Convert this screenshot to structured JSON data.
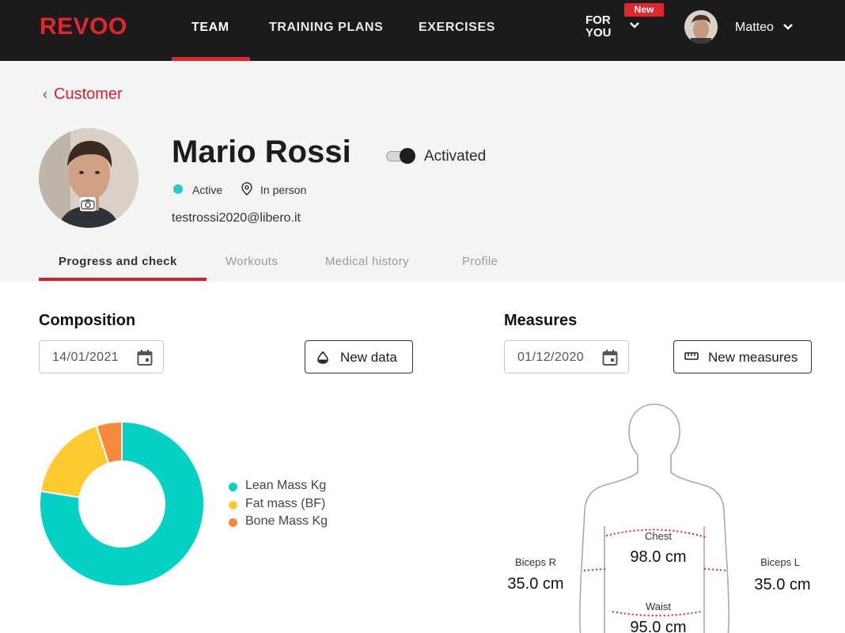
{
  "nav": {
    "logo": "REVOO",
    "items": [
      "TEAM",
      "TRAINING PLANS",
      "EXERCISES"
    ],
    "for_you_line1": "FOR",
    "for_you_line2": "YOU",
    "new_badge": "New",
    "user_name": "Matteo",
    "accent_color": "#e0262e"
  },
  "header": {
    "back_label": "Customer",
    "name": "Mario Rossi",
    "toggle_label": "Activated",
    "status": "Active",
    "mode": "In person",
    "email": "testrossi2020@libero.it"
  },
  "tabs": [
    "Progress and check",
    "Workouts",
    "Medical history",
    "Profile"
  ],
  "composition": {
    "title": "Composition",
    "date": "14/01/2021",
    "button": "New data",
    "legend": [
      {
        "label": "Lean Mass Kg",
        "color": "#03d1c5"
      },
      {
        "label": "Fat mass (BF)",
        "color": "#fdca2f"
      },
      {
        "label": "Bone Mass Kg",
        "color": "#f7893d"
      }
    ],
    "shares": [
      0.775,
      0.175,
      0.05
    ]
  },
  "measures": {
    "title": "Measures",
    "date": "01/12/2020",
    "button": "New measures",
    "chest_label": "Chest",
    "chest_value": "98.0 cm",
    "biceps_r_label": "Biceps R",
    "biceps_r_value": "35.0 cm",
    "biceps_l_label": "Biceps L",
    "biceps_l_value": "35.0 cm",
    "waist_label": "Waist",
    "waist_value": "95.0 cm"
  }
}
